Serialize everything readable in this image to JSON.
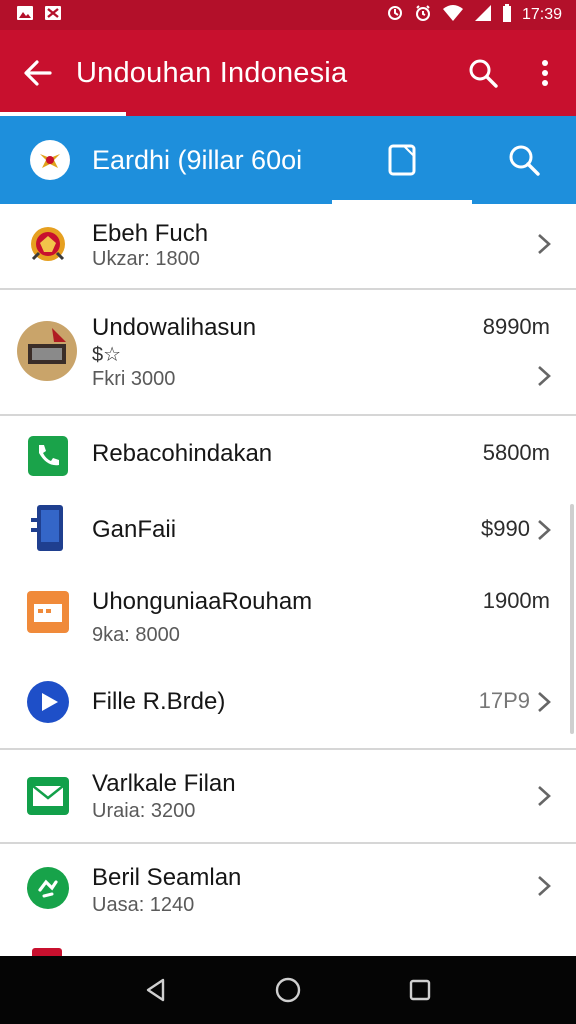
{
  "status_bar": {
    "time": "17:39",
    "icons": [
      "image-icon",
      "bag-icon",
      "sync-icon",
      "alarm-icon",
      "wifi-icon",
      "signal-icon",
      "battery-icon"
    ]
  },
  "app_bar": {
    "title": "Undouhan Indonesia",
    "color": "#c8102e"
  },
  "tab_bar": {
    "title": "Eardhi (9illar 60oi",
    "color": "#1e8fdc"
  },
  "list": {
    "items": [
      {
        "title": "Ebeh Fuch",
        "subtitle": "Ukzar: 1800",
        "value": "",
        "icon": "emblem-icon"
      },
      {
        "title": "Undowalihasun",
        "rating": "$☆",
        "subtitle": "Fkri 3000",
        "value": "8990m",
        "icon": "photo-thumbnail-icon"
      },
      {
        "title": "Rebacohindakan",
        "subtitle": "",
        "value": "5800m",
        "icon": "phone-icon"
      },
      {
        "title": "GanFaii",
        "subtitle": "",
        "value": "$990",
        "icon": "device-icon"
      },
      {
        "title": "UhonguniaaRouham",
        "subtitle": "9ka: 8000",
        "value": "1900m",
        "icon": "calendar-icon"
      },
      {
        "title": "Fille R.Brde)",
        "subtitle": "",
        "value": "17P9",
        "icon": "play-icon"
      },
      {
        "title": "Varlkale Filan",
        "subtitle": "Uraia: 3200",
        "value": "",
        "icon": "mail-icon"
      },
      {
        "title": "Beril Seamlan",
        "subtitle": "Uasa: 1240",
        "value": "",
        "icon": "sync-badge-icon"
      }
    ]
  },
  "nav_bar": {
    "buttons": [
      "back-triangle-icon",
      "home-circle-icon",
      "recents-square-icon"
    ]
  }
}
